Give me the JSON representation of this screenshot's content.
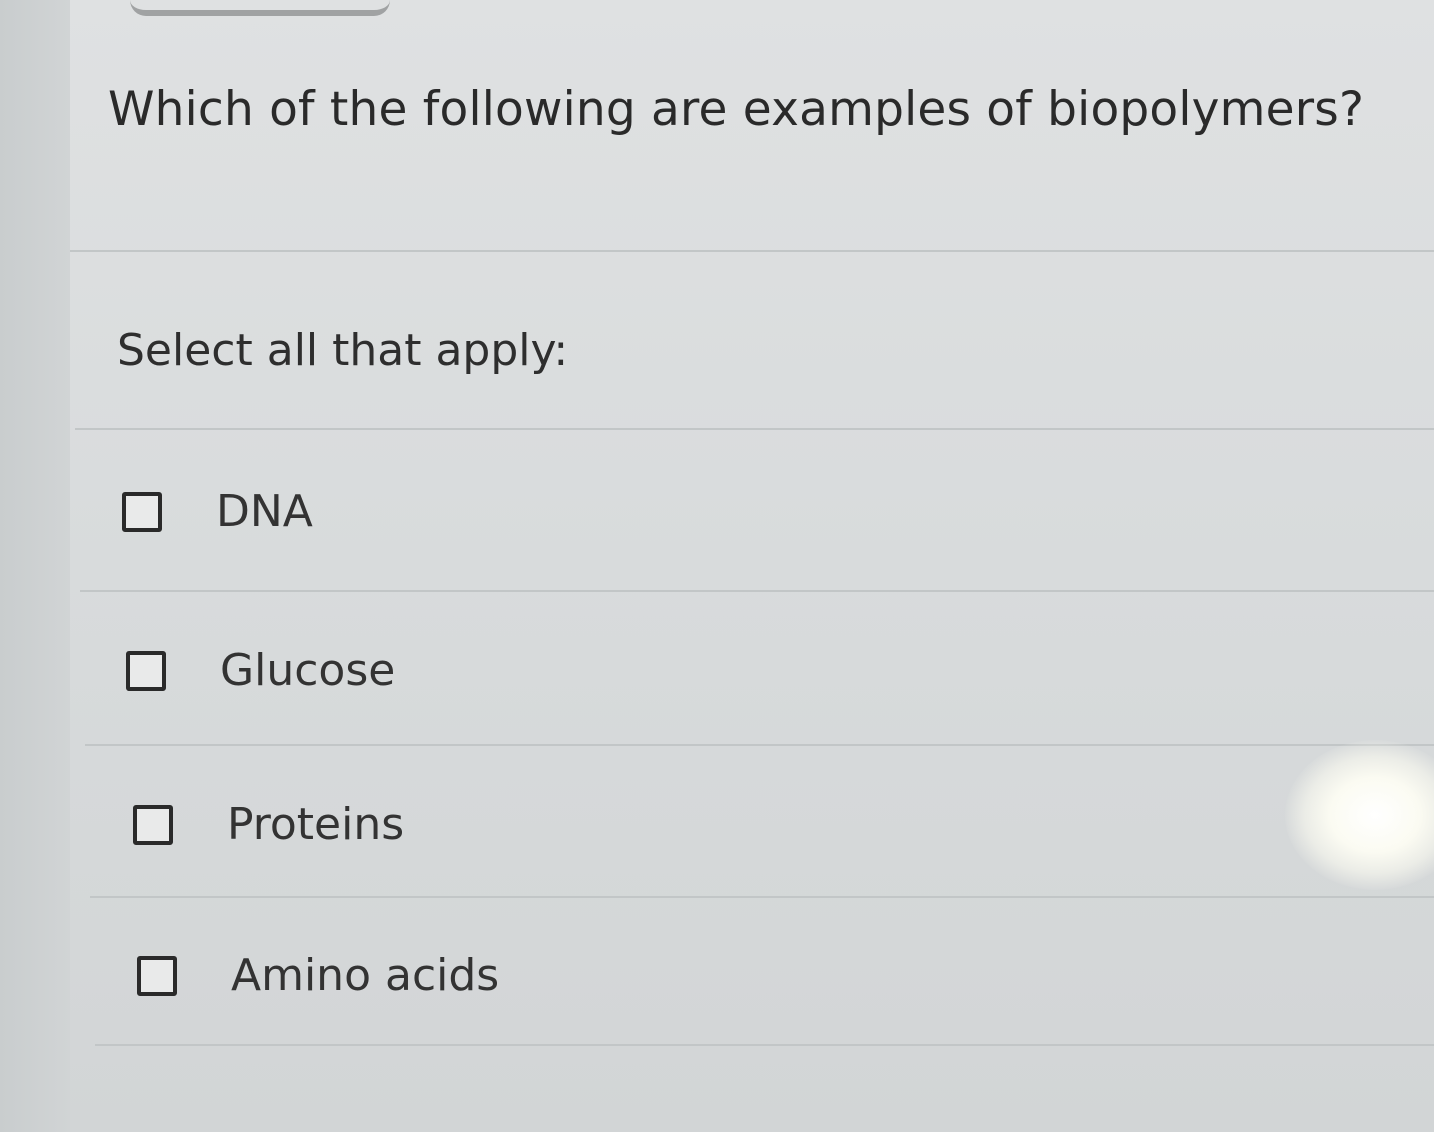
{
  "question": {
    "text": "Which of the following are examples of biopolymers?"
  },
  "instruction": {
    "text": "Select all that apply:"
  },
  "options": [
    {
      "label": "DNA",
      "checked": false
    },
    {
      "label": "Glucose",
      "checked": false
    },
    {
      "label": "Proteins",
      "checked": false
    },
    {
      "label": "Amino acids",
      "checked": false
    }
  ]
}
